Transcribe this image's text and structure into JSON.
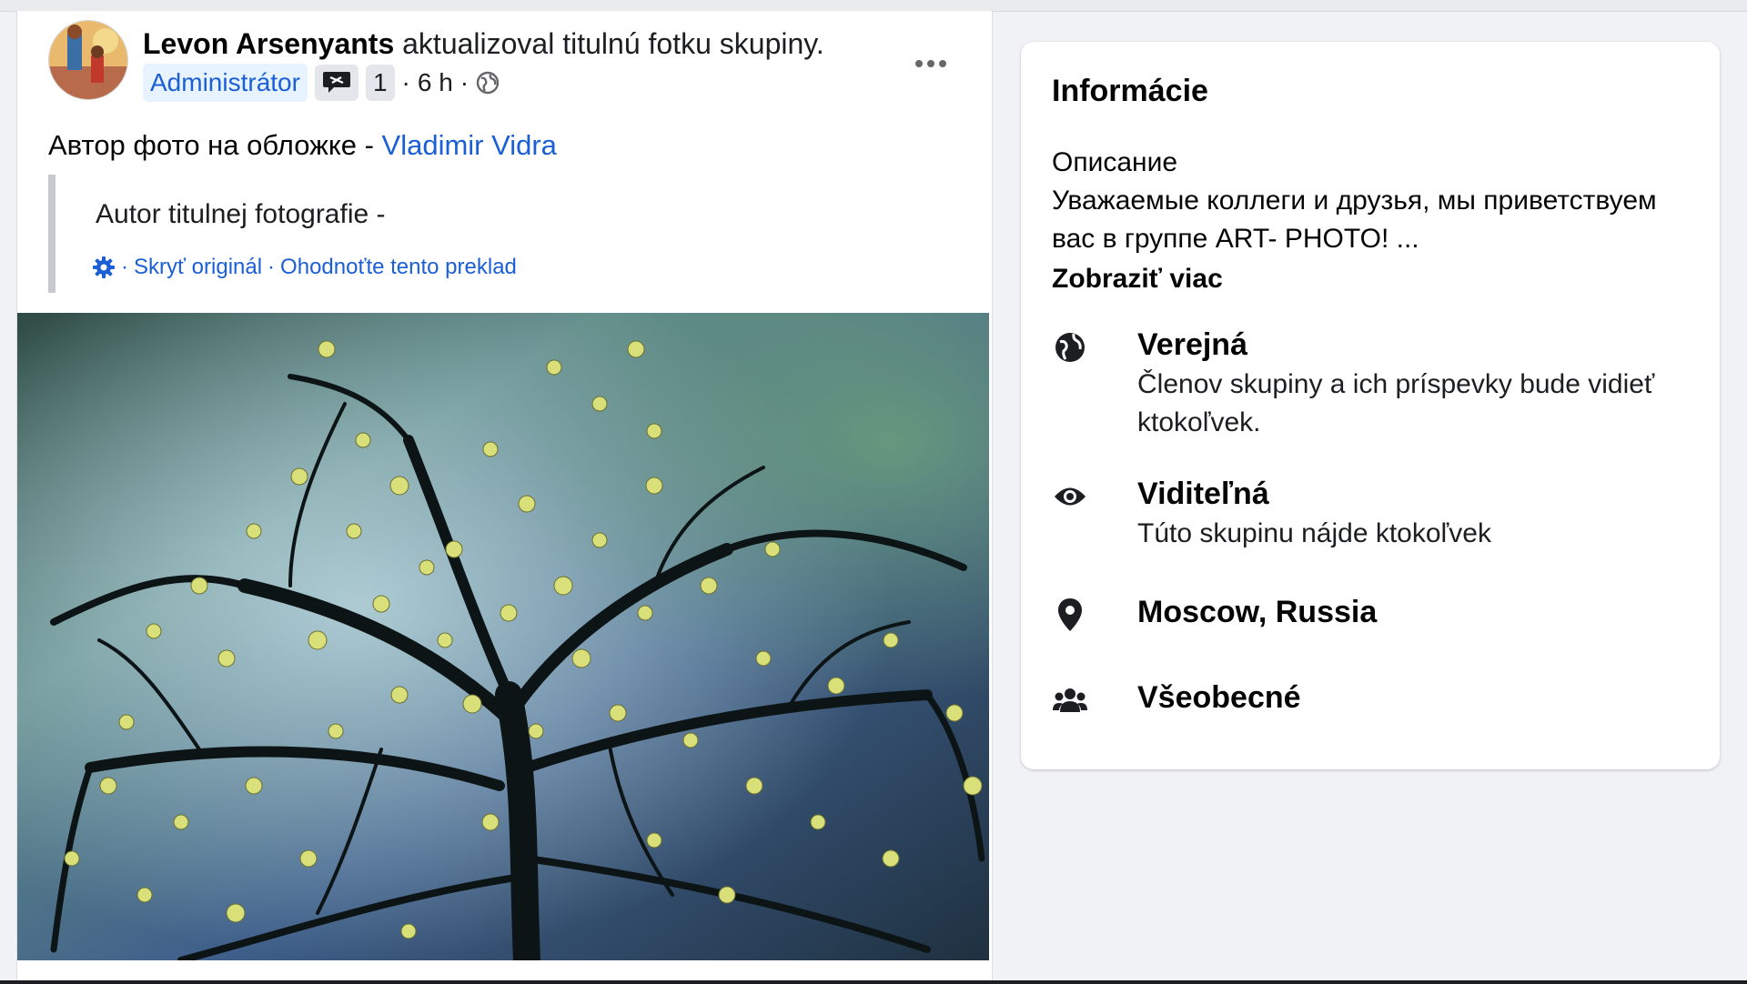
{
  "post": {
    "author": "Levon Arsenyants",
    "action": "aktualizoval titulnú fotku skupiny.",
    "role_badge": "Administrátor",
    "badge_count": "1",
    "time": "6 h",
    "separator": "·",
    "text_prefix": "Автор фото на обложке - ",
    "text_link": "Vladimir Vidra",
    "translation": {
      "text": "Autor titulnej fotografie -",
      "hide_original": "Skryť originál",
      "rate_translation": "Ohodnoťte tento preklad",
      "separator": "·"
    },
    "icons": {
      "more": "more-horizontal-icon",
      "privacy": "globe-icon",
      "badge": "speech-bubble-icon",
      "settings": "gear-icon"
    }
  },
  "info": {
    "title": "Informácie",
    "description_label": "Описание",
    "description_text": "Уважаемые коллеги и друзья, мы приветствуем вас в группе ART- PHOTO! ...",
    "show_more": "Zobraziť viac",
    "rows": [
      {
        "icon": "globe-icon",
        "title": "Verejná",
        "subtitle": "Členov skupiny a ich príspevky bude vidieť ktokoľvek."
      },
      {
        "icon": "eye-icon",
        "title": "Viditeľná",
        "subtitle": "Túto skupinu nájde ktokoľvek"
      },
      {
        "icon": "location-pin-icon",
        "title": "Moscow, Russia",
        "subtitle": ""
      },
      {
        "icon": "people-icon",
        "title": "Všeobecné",
        "subtitle": ""
      }
    ]
  },
  "colors": {
    "link_blue": "#1b5fd6",
    "admin_badge_bg": "#e7f3ff",
    "page_bg": "#f0f2f5"
  }
}
